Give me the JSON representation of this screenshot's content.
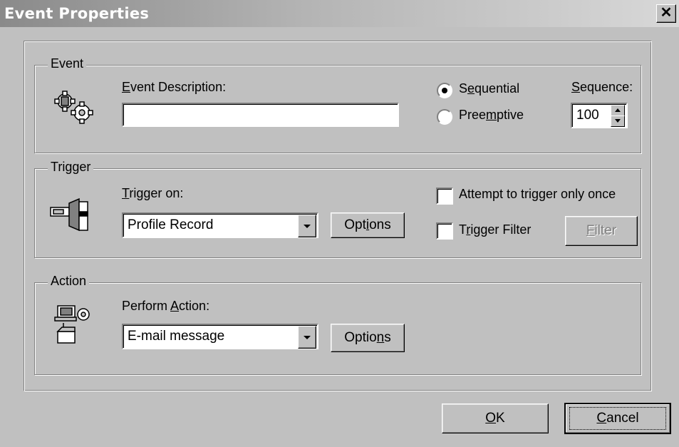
{
  "window": {
    "title": "Event Properties",
    "close_label": "✕"
  },
  "event_group": {
    "label": "Event",
    "icon": "gears-icon",
    "description_label_prefix": "",
    "description_label_mnemonic": "E",
    "description_label_rest": "vent Description:",
    "description_value": "",
    "sequential_label_a": "S",
    "sequential_label_mn": "e",
    "sequential_label_b": "quential",
    "sequential_selected": true,
    "preemptive_label_a": "Pree",
    "preemptive_label_mn": "m",
    "preemptive_label_b": "ptive",
    "preemptive_selected": false,
    "sequence_label_mn": "S",
    "sequence_label_rest": "equence:",
    "sequence_value": "100"
  },
  "trigger_group": {
    "label": "Trigger",
    "icon": "trigger-plug-icon",
    "trigger_on_mn": "T",
    "trigger_on_rest": "rigger on:",
    "trigger_on_value": "Profile Record",
    "options_a": "Opt",
    "options_mn": "i",
    "options_b": "ons",
    "attempt_once_label": "Attempt to trigger only once",
    "attempt_once_checked": false,
    "filter_check_a": "T",
    "filter_check_mn": "r",
    "filter_check_b": "igger Filter",
    "filter_checked": false,
    "filter_button_mn": "F",
    "filter_button_rest": "ilter"
  },
  "action_group": {
    "label": "Action",
    "icon": "computer-action-icon",
    "perform_a": "Perform ",
    "perform_mn": "A",
    "perform_b": "ction:",
    "perform_value": "E-mail message",
    "options_a": "Optio",
    "options_mn": "n",
    "options_b": "s"
  },
  "footer": {
    "ok_mn": "O",
    "ok_rest": "K",
    "cancel_mn": "C",
    "cancel_rest": "ancel"
  }
}
